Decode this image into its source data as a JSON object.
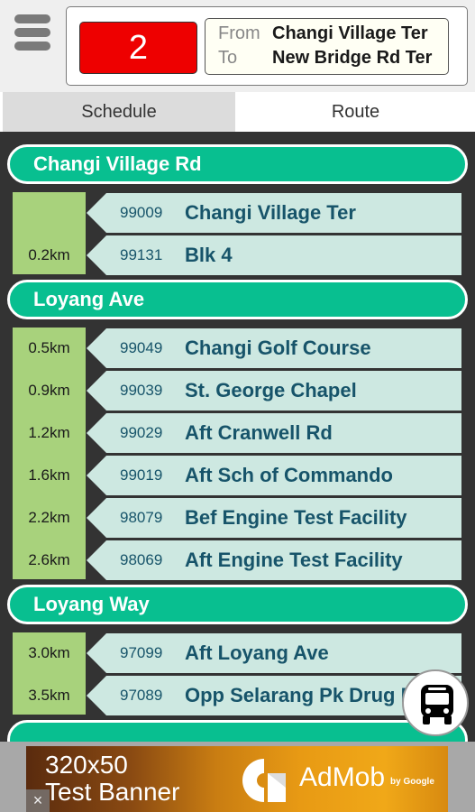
{
  "header": {
    "menu_icon": "hamburger-menu-icon",
    "bus_number": "2",
    "bus_number_color": "#ee0000",
    "from_label": "From",
    "from_value": "Changi Village Ter",
    "to_label": "To",
    "to_value": "New Bridge Rd Ter"
  },
  "tabs": [
    {
      "label": "Schedule",
      "active": false
    },
    {
      "label": "Route",
      "active": true
    }
  ],
  "colors": {
    "road_header": "#08bf90",
    "stop_bg": "#cde8e1",
    "stop_text": "#17546a",
    "distance_bg": "#a8d27c",
    "content_bg": "#333333"
  },
  "roads": [
    {
      "name": "Changi Village Rd",
      "stops": [
        {
          "distance": "",
          "code": "99009",
          "name": "Changi Village Ter"
        },
        {
          "distance": "0.2km",
          "code": "99131",
          "name": "Blk 4"
        }
      ]
    },
    {
      "name": "Loyang Ave",
      "stops": [
        {
          "distance": "0.5km",
          "code": "99049",
          "name": "Changi Golf Course"
        },
        {
          "distance": "0.9km",
          "code": "99039",
          "name": "St. George Chapel"
        },
        {
          "distance": "1.2km",
          "code": "99029",
          "name": "Aft Cranwell Rd"
        },
        {
          "distance": "1.6km",
          "code": "99019",
          "name": "Aft Sch of Commando"
        },
        {
          "distance": "2.2km",
          "code": "98079",
          "name": "Bef Engine Test Facility"
        },
        {
          "distance": "2.6km",
          "code": "98069",
          "name": "Aft Engine Test Facility"
        }
      ]
    },
    {
      "name": "Loyang Way",
      "stops": [
        {
          "distance": "3.0km",
          "code": "97099",
          "name": "Aft Loyang Ave"
        },
        {
          "distance": "3.5km",
          "code": "97089",
          "name": "Opp Selarang Pk Drug Rehab"
        }
      ]
    }
  ],
  "fab": {
    "icon": "bus-icon"
  },
  "ad": {
    "line1": "320x50",
    "line2": "Test Banner",
    "brand": "AdMob",
    "by": "by Google",
    "close": "×"
  }
}
